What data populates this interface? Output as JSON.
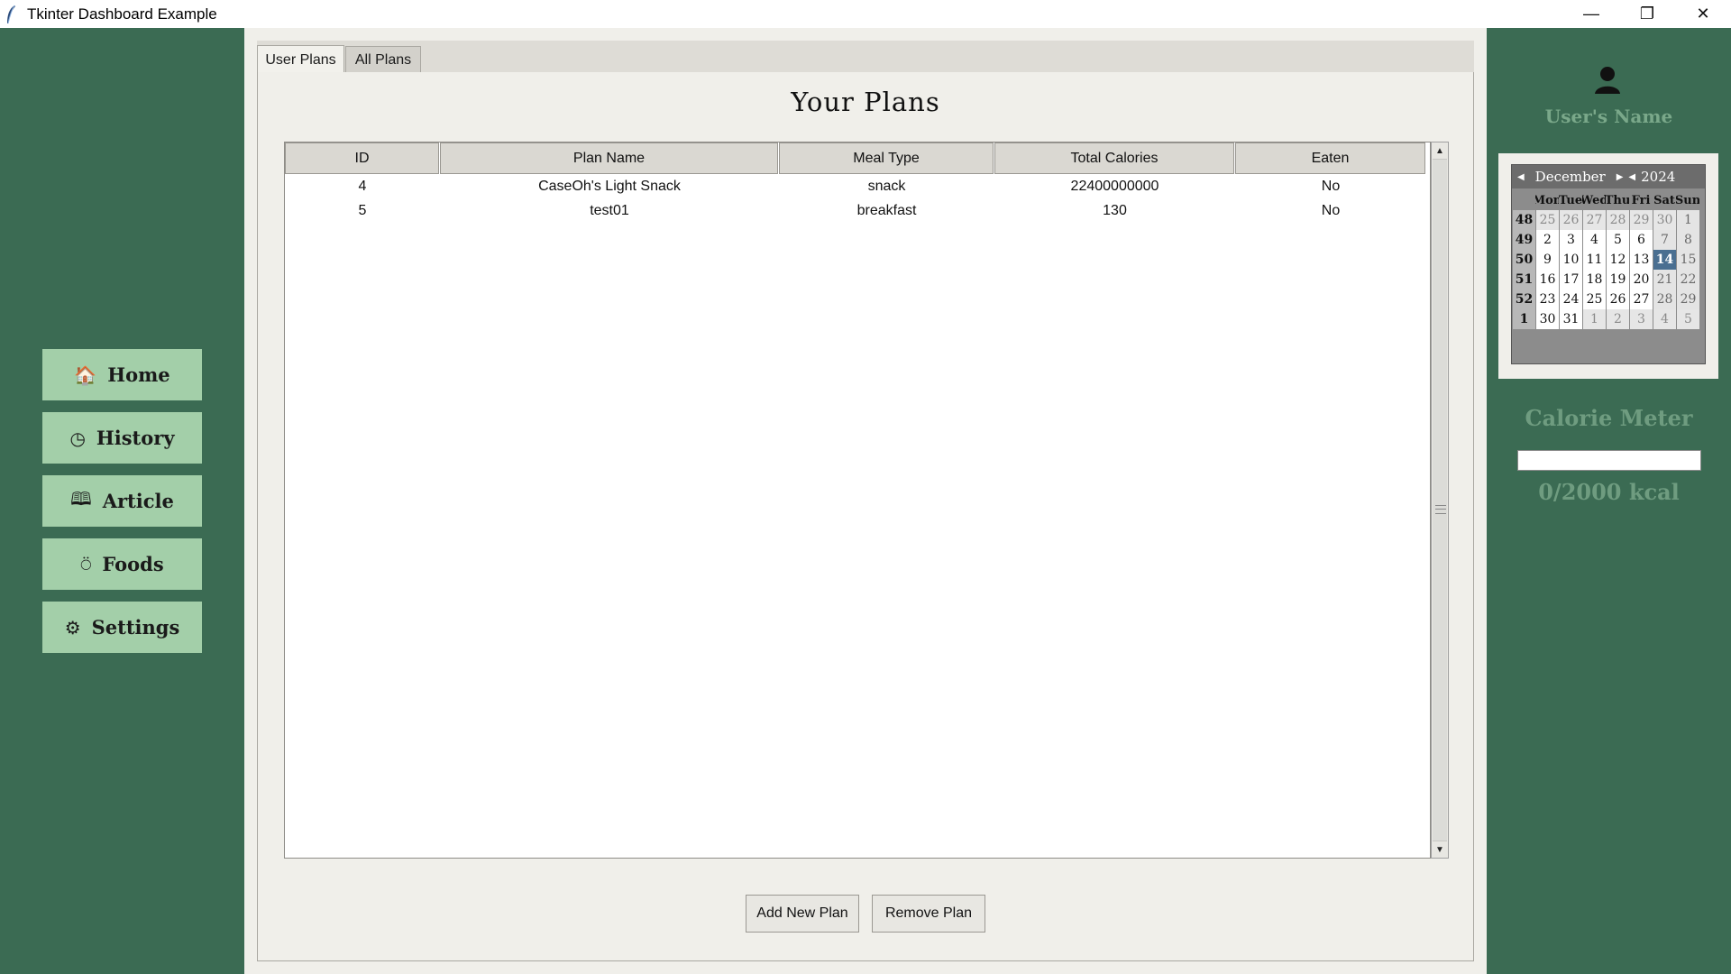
{
  "window": {
    "title": "Tkinter Dashboard Example",
    "controls": {
      "minimize": "—",
      "maximize": "❐",
      "close": "✕"
    }
  },
  "sidebar": {
    "items": [
      {
        "icon": "home-icon",
        "glyph": "🏠",
        "label": "Home"
      },
      {
        "icon": "clock-icon",
        "glyph": "◷",
        "label": "History"
      },
      {
        "icon": "book-icon",
        "glyph": "🕮",
        "label": "Article"
      },
      {
        "icon": "drumstick-icon",
        "glyph": "⍥",
        "label": "Foods"
      },
      {
        "icon": "gear-icon",
        "glyph": "⚙",
        "label": "Settings"
      }
    ]
  },
  "tabs": [
    {
      "label": "User Plans",
      "active": true
    },
    {
      "label": "All Plans",
      "active": false
    }
  ],
  "main": {
    "heading": "Your Plans",
    "columns": [
      "ID",
      "Plan Name",
      "Meal Type",
      "Total Calories",
      "Eaten"
    ],
    "rows": [
      [
        "4",
        "CaseOh's Light Snack",
        "snack",
        "22400000000",
        "No"
      ],
      [
        "5",
        "test01",
        "breakfast",
        "130",
        "No"
      ]
    ],
    "add_button": "Add New Plan",
    "remove_button": "Remove Plan"
  },
  "user": {
    "name": "User's Name",
    "avatar_icon": "user-icon"
  },
  "calendar": {
    "month": "December",
    "year": "2024",
    "weekdays": [
      "Mon",
      "Tue",
      "Wed",
      "Thu",
      "Fri",
      "Sat",
      "Sun"
    ],
    "selected": "14",
    "weeks": [
      {
        "week": "48",
        "days": [
          "25",
          "26",
          "27",
          "28",
          "29",
          "30",
          "1"
        ],
        "other": [
          0,
          1,
          2,
          3,
          4,
          5
        ]
      },
      {
        "week": "49",
        "days": [
          "2",
          "3",
          "4",
          "5",
          "6",
          "7",
          "8"
        ],
        "other": []
      },
      {
        "week": "50",
        "days": [
          "9",
          "10",
          "11",
          "12",
          "13",
          "14",
          "15"
        ],
        "other": []
      },
      {
        "week": "51",
        "days": [
          "16",
          "17",
          "18",
          "19",
          "20",
          "21",
          "22"
        ],
        "other": []
      },
      {
        "week": "52",
        "days": [
          "23",
          "24",
          "25",
          "26",
          "27",
          "28",
          "29"
        ],
        "other": []
      },
      {
        "week": "1",
        "days": [
          "30",
          "31",
          "1",
          "2",
          "3",
          "4",
          "5"
        ],
        "other": [
          2,
          3,
          4,
          5,
          6
        ]
      }
    ]
  },
  "calorie_meter": {
    "label": "Calorie Meter",
    "value_text": "0/2000 kcal",
    "progress_fraction": 0
  },
  "colors": {
    "background": "#3b6b53",
    "nav_button": "#a3cfa9",
    "panel": "#f0efea",
    "selected_day": "#4a6f91",
    "accent_text": "#6f9c80"
  }
}
